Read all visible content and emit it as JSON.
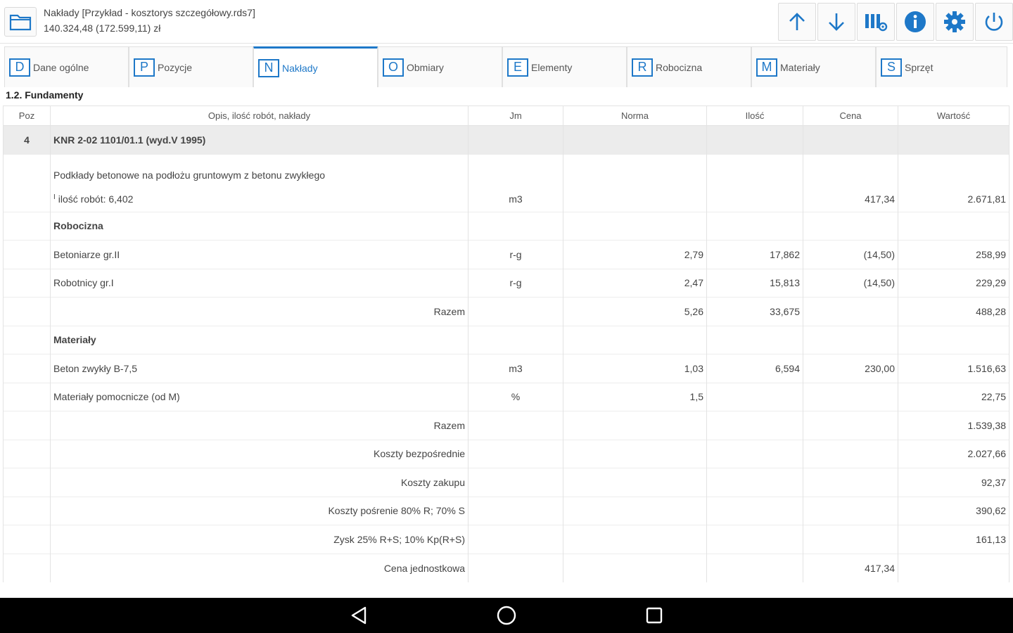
{
  "header": {
    "title": "Nakłady [Przykład - kosztorys szczegółowy.rds7]",
    "subtitle": "140.324,48 (172.599,11) zł"
  },
  "toolbar": {
    "icons": [
      "folder-icon",
      "arrow-up-icon",
      "arrow-down-icon",
      "columns-settings-icon",
      "info-icon",
      "gear-icon",
      "power-icon"
    ],
    "accent": "#1e78c8"
  },
  "tabs": [
    {
      "key": "D",
      "label": "Dane ogólne"
    },
    {
      "key": "P",
      "label": "Pozycje"
    },
    {
      "key": "N",
      "label": "Nakłady"
    },
    {
      "key": "O",
      "label": "Obmiary"
    },
    {
      "key": "E",
      "label": "Elementy"
    },
    {
      "key": "R",
      "label": "Robocizna"
    },
    {
      "key": "M",
      "label": "Materiały"
    },
    {
      "key": "S",
      "label": "Sprzęt"
    }
  ],
  "active_tab": "Nakłady",
  "section": "1.2. Fundamenty",
  "table": {
    "headers": [
      "Poz",
      "Opis, ilość robót, nakłady",
      "Jm",
      "Norma",
      "Ilość",
      "Cena",
      "Wartość"
    ],
    "position": {
      "poz": "4",
      "knr": "KNR 2-02 1101/01.1 (wyd.V 1995)",
      "description": "Podkłady betonowe na podłożu gruntowym z betonu zwykłego",
      "marker": "I",
      "qty_text": "ilość robót: 6,402",
      "jm": "m3",
      "cena": "417,34",
      "wartosc": "2.671,81"
    },
    "rows": [
      {
        "opis": "Robocizna",
        "type": "category"
      },
      {
        "opis": "Betoniarze gr.II",
        "jm": "r-g",
        "norma": "2,79",
        "ilosc": "17,862",
        "cena": "(14,50)",
        "wartosc": "258,99"
      },
      {
        "opis": "Robotnicy gr.I",
        "jm": "r-g",
        "norma": "2,47",
        "ilosc": "15,813",
        "cena": "(14,50)",
        "wartosc": "229,29"
      },
      {
        "opis": "Razem",
        "type": "sum",
        "norma": "5,26",
        "ilosc": "33,675",
        "wartosc": "488,28"
      },
      {
        "opis": "Materiały",
        "type": "category"
      },
      {
        "opis": "Beton zwykły B-7,5",
        "jm": "m3",
        "norma": "1,03",
        "ilosc": "6,594",
        "cena": "230,00",
        "wartosc": "1.516,63"
      },
      {
        "opis": "Materiały pomocnicze (od M)",
        "jm": "%",
        "norma": "1,5",
        "wartosc": "22,75"
      },
      {
        "opis": "Razem",
        "type": "sum",
        "wartosc": "1.539,38"
      },
      {
        "opis": "Koszty bezpośrednie",
        "type": "sum",
        "wartosc": "2.027,66"
      },
      {
        "opis": "Koszty zakupu",
        "type": "sum",
        "wartosc": "92,37"
      },
      {
        "opis": "Koszty pośrenie 80% R; 70% S",
        "type": "sum",
        "wartosc": "390,62"
      },
      {
        "opis": "Zysk 25% R+S; 10% Kp(R+S)",
        "type": "sum",
        "wartosc": "161,13"
      },
      {
        "opis": "Cena jednostkowa",
        "type": "sum",
        "cena": "417,34"
      }
    ]
  },
  "android_nav": [
    "back-icon",
    "home-icon",
    "recents-icon"
  ]
}
